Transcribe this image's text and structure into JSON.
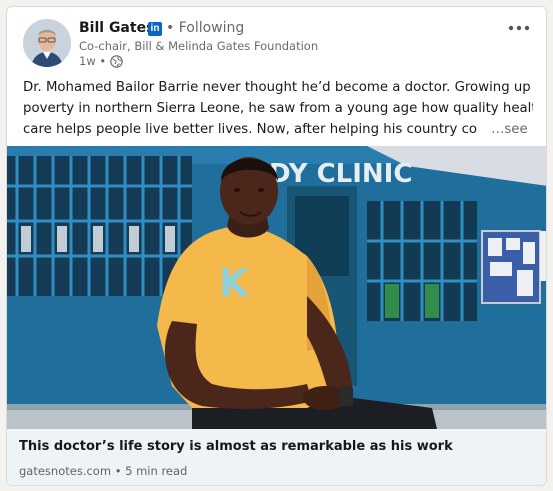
{
  "post": {
    "author": {
      "name": "Bill Gates",
      "linkedin_badge": "in",
      "following": "• Following",
      "headline": "Co-chair, Bill & Melinda Gates Foundation",
      "time": "1w •",
      "visibility_icon": "globe-icon"
    },
    "menu_icon": "more-horizontal-icon",
    "text_lines": [
      "Dr. Mohamed Bailor Barrie never thought he’d become a doctor. Growing up in",
      "poverty in northern Sierra Leone, he saw from a young age how quality health",
      "care helps people live better lives. Now, after helping his country co"
    ],
    "see_more": "…see more",
    "image": {
      "sign_text": "DY CLINIC",
      "shirt_text": "K"
    },
    "link": {
      "title": "This doctor’s life story is almost as remarkable as his work",
      "source": "gatesnotes.com • 5 min read"
    }
  },
  "colors": {
    "linkedin_blue": "#0a66c2",
    "footer_bg": "#eef3f8",
    "clinic_wall": "#1f6e9b",
    "shirt": "#f5b84a"
  }
}
